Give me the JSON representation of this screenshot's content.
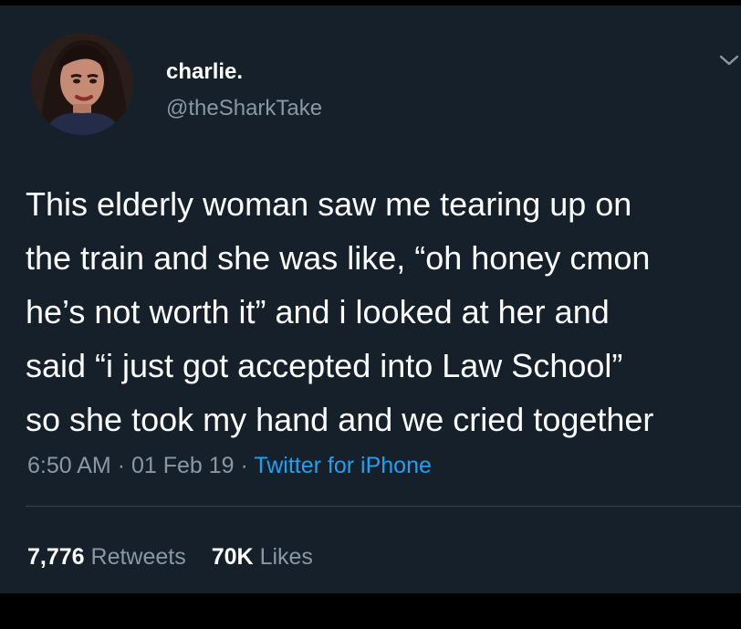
{
  "tweet": {
    "author": {
      "display_name": "charlie.",
      "handle": "@theSharkTake"
    },
    "text_lines": [
      "This elderly woman saw me tearing up on",
      "the train and she was like, “oh honey cmon",
      "he’s not worth it” and i looked at her and",
      "said “i just got accepted into Law School”",
      "so she took my hand and we cried together"
    ],
    "time": "6:50 AM",
    "separator": "·",
    "date": "01 Feb 19",
    "source": "Twitter for iPhone",
    "stats": {
      "retweets_count": "7,776",
      "retweets_label": "Retweets",
      "likes_count": "70K",
      "likes_label": "Likes"
    },
    "menu_icon": "chevron-down-icon"
  },
  "colors": {
    "background": "#15202b",
    "outer_background": "#000000",
    "text_primary": "#ffffff",
    "text_secondary": "#8899a6",
    "link": "#1da1f2",
    "divider": "#38444d"
  }
}
